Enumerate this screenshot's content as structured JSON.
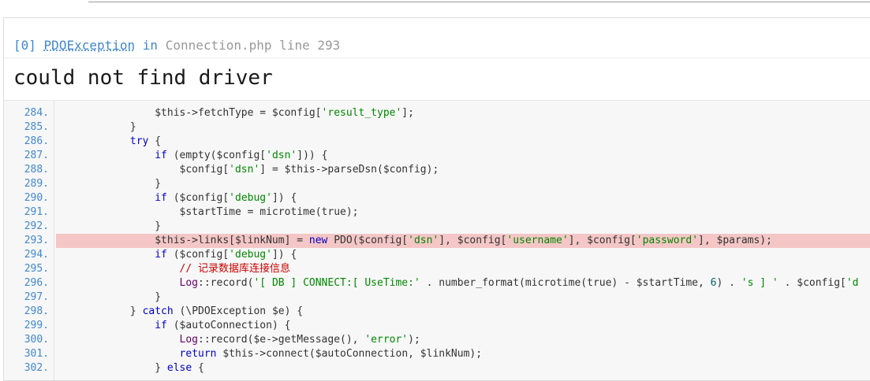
{
  "exception": {
    "index_label": "[0]",
    "class_name": "PDOException",
    "in_word": "in",
    "file_location": "Connection.php line 293",
    "message": "could not find driver"
  },
  "highlight_line": "293.",
  "source_lines": [
    {
      "num": "284.",
      "tokens": [
        [
          "p",
          "                $this->fetchType = $config["
        ],
        [
          "s",
          "'result_type'"
        ],
        [
          "p",
          "];"
        ]
      ]
    },
    {
      "num": "285.",
      "tokens": [
        [
          "p",
          "            }"
        ]
      ]
    },
    {
      "num": "286.",
      "tokens": [
        [
          "p",
          "            "
        ],
        [
          "k",
          "try"
        ],
        [
          "p",
          " {"
        ]
      ]
    },
    {
      "num": "287.",
      "tokens": [
        [
          "p",
          "                "
        ],
        [
          "k",
          "if"
        ],
        [
          "p",
          " (empty($config["
        ],
        [
          "s",
          "'dsn'"
        ],
        [
          "p",
          "])) {"
        ]
      ]
    },
    {
      "num": "288.",
      "tokens": [
        [
          "p",
          "                    $config["
        ],
        [
          "s",
          "'dsn'"
        ],
        [
          "p",
          "] = $this->parseDsn($config);"
        ]
      ]
    },
    {
      "num": "289.",
      "tokens": [
        [
          "p",
          "                }"
        ]
      ]
    },
    {
      "num": "290.",
      "tokens": [
        [
          "p",
          "                "
        ],
        [
          "k",
          "if"
        ],
        [
          "p",
          " ($config["
        ],
        [
          "s",
          "'debug'"
        ],
        [
          "p",
          "]) {"
        ]
      ]
    },
    {
      "num": "291.",
      "tokens": [
        [
          "p",
          "                    $startTime = microtime(true);"
        ]
      ]
    },
    {
      "num": "292.",
      "tokens": [
        [
          "p",
          "                }"
        ]
      ]
    },
    {
      "num": "293.",
      "tokens": [
        [
          "p",
          "                $this->links[$linkNum] = "
        ],
        [
          "k",
          "new"
        ],
        [
          "p",
          " PDO($config["
        ],
        [
          "s",
          "'dsn'"
        ],
        [
          "p",
          "], $config["
        ],
        [
          "s",
          "'username'"
        ],
        [
          "p",
          "], $config["
        ],
        [
          "s",
          "'password'"
        ],
        [
          "p",
          "], $params);"
        ]
      ]
    },
    {
      "num": "294.",
      "tokens": [
        [
          "p",
          "                "
        ],
        [
          "k",
          "if"
        ],
        [
          "p",
          " ($config["
        ],
        [
          "s",
          "'debug'"
        ],
        [
          "p",
          "]) {"
        ]
      ]
    },
    {
      "num": "295.",
      "tokens": [
        [
          "c",
          "                    // 记录数据库连接信息"
        ]
      ]
    },
    {
      "num": "296.",
      "tokens": [
        [
          "t",
          "                    Log"
        ],
        [
          "p",
          "::record("
        ],
        [
          "s",
          "'[ DB ] CONNECT:[ UseTime:'"
        ],
        [
          "p",
          " . number_format(microtime(true) - $startTime, "
        ],
        [
          "n",
          "6"
        ],
        [
          "p",
          ") . "
        ],
        [
          "s",
          "'s ] '"
        ],
        [
          "p",
          " . $config["
        ],
        [
          "s",
          "'d"
        ]
      ]
    },
    {
      "num": "297.",
      "tokens": [
        [
          "p",
          "                }"
        ]
      ]
    },
    {
      "num": "298.",
      "tokens": [
        [
          "p",
          "            } "
        ],
        [
          "k",
          "catch"
        ],
        [
          "p",
          " (\\PDOException $e) {"
        ]
      ]
    },
    {
      "num": "299.",
      "tokens": [
        [
          "p",
          "                "
        ],
        [
          "k",
          "if"
        ],
        [
          "p",
          " ($autoConnection) {"
        ]
      ]
    },
    {
      "num": "300.",
      "tokens": [
        [
          "t",
          "                    Log"
        ],
        [
          "p",
          "::record($e->getMessage(), "
        ],
        [
          "s",
          "'error'"
        ],
        [
          "p",
          ");"
        ]
      ]
    },
    {
      "num": "301.",
      "tokens": [
        [
          "p",
          "                    "
        ],
        [
          "k",
          "return"
        ],
        [
          "p",
          " $this->connect($autoConnection, $linkNum);"
        ]
      ]
    },
    {
      "num": "302.",
      "tokens": [
        [
          "p",
          "                } "
        ],
        [
          "k",
          "else"
        ],
        [
          "p",
          " {"
        ]
      ]
    }
  ],
  "colors": {
    "accent": "#4288ce",
    "highlight_bg": "#f4c6c6",
    "keyword": "#0000c8",
    "string": "#008800",
    "comment": "#cc0000"
  }
}
